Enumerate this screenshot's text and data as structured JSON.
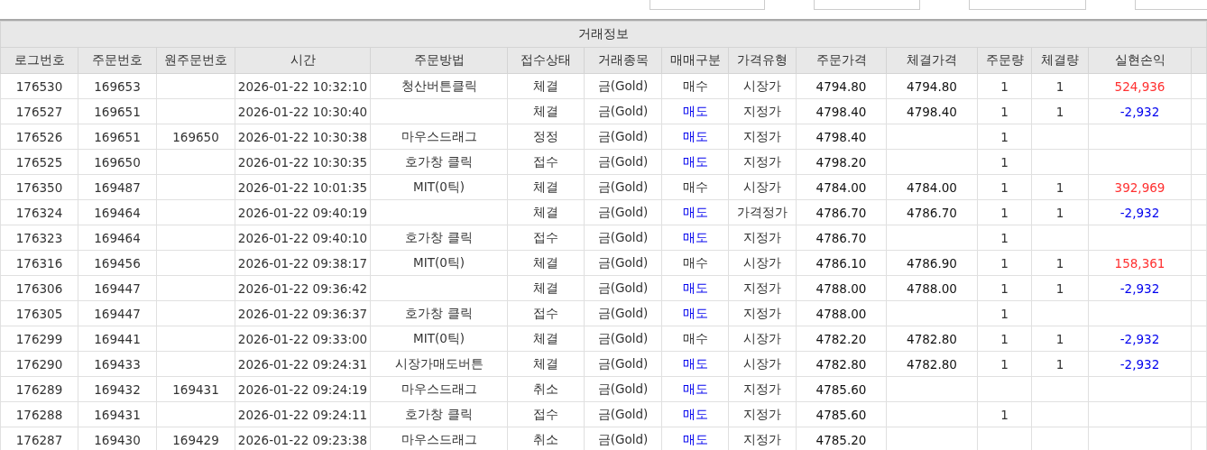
{
  "table": {
    "group_header": "거래정보",
    "columns": [
      "로그번호",
      "주문번호",
      "원주문번호",
      "시간",
      "주문방법",
      "접수상태",
      "거래종목",
      "매매구분",
      "가격유형",
      "주문가격",
      "체결가격",
      "주문량",
      "체결량",
      "실현손익"
    ],
    "rows": [
      {
        "cells": [
          "176530",
          "169653",
          "",
          "2026-01-22 10:32:10",
          "청산버튼클릭",
          "체결",
          "금(Gold)",
          "매수",
          "시장가",
          "4794.80",
          "4794.80",
          "1",
          "1",
          "524,936"
        ],
        "sell": false,
        "loss": false
      },
      {
        "cells": [
          "176527",
          "169651",
          "",
          "2026-01-22 10:30:40",
          "",
          "체결",
          "금(Gold)",
          "매도",
          "지정가",
          "4798.40",
          "4798.40",
          "1",
          "1",
          "-2,932"
        ],
        "sell": true,
        "loss": true
      },
      {
        "cells": [
          "176526",
          "169651",
          "169650",
          "2026-01-22 10:30:38",
          "마우스드래그",
          "정정",
          "금(Gold)",
          "매도",
          "지정가",
          "4798.40",
          "",
          "1",
          "",
          ""
        ],
        "sell": true
      },
      {
        "cells": [
          "176525",
          "169650",
          "",
          "2026-01-22 10:30:35",
          "호가창 클릭",
          "접수",
          "금(Gold)",
          "매도",
          "지정가",
          "4798.20",
          "",
          "1",
          "",
          ""
        ],
        "sell": true
      },
      {
        "cells": [
          "176350",
          "169487",
          "",
          "2026-01-22 10:01:35",
          "MIT(0틱)",
          "체결",
          "금(Gold)",
          "매수",
          "시장가",
          "4784.00",
          "4784.00",
          "1",
          "1",
          "392,969"
        ],
        "sell": false,
        "loss": false
      },
      {
        "cells": [
          "176324",
          "169464",
          "",
          "2026-01-22 09:40:19",
          "",
          "체결",
          "금(Gold)",
          "매도",
          "가격정가",
          "4786.70",
          "4786.70",
          "1",
          "1",
          "-2,932"
        ],
        "sell": true,
        "loss": true
      },
      {
        "cells": [
          "176323",
          "169464",
          "",
          "2026-01-22 09:40:10",
          "호가창 클릭",
          "접수",
          "금(Gold)",
          "매도",
          "지정가",
          "4786.70",
          "",
          "1",
          "",
          ""
        ],
        "sell": true
      },
      {
        "cells": [
          "176316",
          "169456",
          "",
          "2026-01-22 09:38:17",
          "MIT(0틱)",
          "체결",
          "금(Gold)",
          "매수",
          "시장가",
          "4786.10",
          "4786.90",
          "1",
          "1",
          "158,361"
        ],
        "sell": false,
        "loss": false
      },
      {
        "cells": [
          "176306",
          "169447",
          "",
          "2026-01-22 09:36:42",
          "",
          "체결",
          "금(Gold)",
          "매도",
          "지정가",
          "4788.00",
          "4788.00",
          "1",
          "1",
          "-2,932"
        ],
        "sell": true,
        "loss": true
      },
      {
        "cells": [
          "176305",
          "169447",
          "",
          "2026-01-22 09:36:37",
          "호가창 클릭",
          "접수",
          "금(Gold)",
          "매도",
          "지정가",
          "4788.00",
          "",
          "1",
          "",
          ""
        ],
        "sell": true
      },
      {
        "cells": [
          "176299",
          "169441",
          "",
          "2026-01-22 09:33:00",
          "MIT(0틱)",
          "체결",
          "금(Gold)",
          "매수",
          "시장가",
          "4782.20",
          "4782.80",
          "1",
          "1",
          "-2,932"
        ],
        "sell": false,
        "loss": true
      },
      {
        "cells": [
          "176290",
          "169433",
          "",
          "2026-01-22 09:24:31",
          "시장가매도버튼",
          "체결",
          "금(Gold)",
          "매도",
          "시장가",
          "4782.80",
          "4782.80",
          "1",
          "1",
          "-2,932"
        ],
        "sell": true,
        "loss": true
      },
      {
        "cells": [
          "176289",
          "169432",
          "169431",
          "2026-01-22 09:24:19",
          "마우스드래그",
          "취소",
          "금(Gold)",
          "매도",
          "지정가",
          "4785.60",
          "",
          "",
          "",
          ""
        ],
        "sell": true
      },
      {
        "cells": [
          "176288",
          "169431",
          "",
          "2026-01-22 09:24:11",
          "호가창 클릭",
          "접수",
          "금(Gold)",
          "매도",
          "지정가",
          "4785.60",
          "",
          "1",
          "",
          ""
        ],
        "sell": true
      },
      {
        "cells": [
          "176287",
          "169430",
          "169429",
          "2026-01-22 09:23:38",
          "마우스드래그",
          "취소",
          "금(Gold)",
          "매도",
          "지정가",
          "4785.20",
          "",
          "",
          "",
          ""
        ],
        "sell": true
      }
    ]
  }
}
